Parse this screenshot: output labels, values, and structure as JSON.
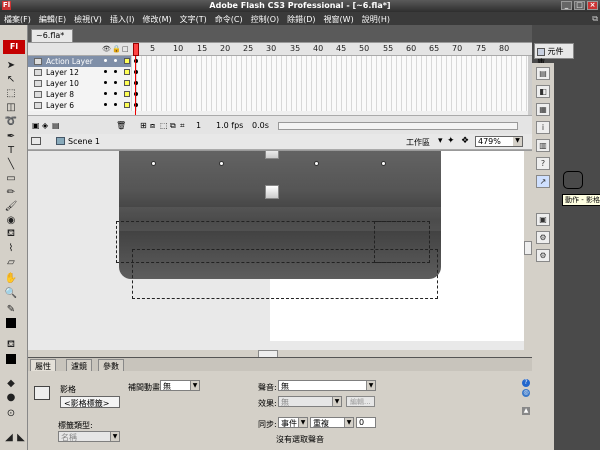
{
  "window": {
    "title": "Adobe Flash CS3 Professional - [~6.fla*]",
    "app_icon": "Fl"
  },
  "menu": [
    "檔案(F)",
    "編輯(E)",
    "檢視(V)",
    "插入(I)",
    "修改(M)",
    "文字(T)",
    "命令(C)",
    "控制(O)",
    "除錯(D)",
    "視窗(W)",
    "說明(H)"
  ],
  "document": {
    "tab": "~6.fla*"
  },
  "timeline": {
    "frame_numbers": [
      "5",
      "10",
      "15",
      "20",
      "25",
      "30",
      "35",
      "40",
      "45",
      "50",
      "55",
      "60",
      "65",
      "70",
      "75",
      "80"
    ],
    "layers": [
      {
        "name": "Action Layer",
        "selected": true
      },
      {
        "name": "Layer 12",
        "selected": false
      },
      {
        "name": "Layer 10",
        "selected": false
      },
      {
        "name": "Layer 8",
        "selected": false
      },
      {
        "name": "Layer 6",
        "selected": false
      }
    ],
    "current_frame": "1",
    "fps": "1.0 fps",
    "time": "0.0s"
  },
  "scene": {
    "label": "Scene 1",
    "workspace": "工作區",
    "zoom": "479%"
  },
  "properties": {
    "tabs": [
      "屬性",
      "濾鏡",
      "參數"
    ],
    "frame_label": "影格",
    "frame_name_placeholder": "<影格標籤>",
    "label_type_label": "標籤類型:",
    "label_type_value": "名稱",
    "tween_label": "補間動畫:",
    "tween_value": "無",
    "sound_label": "聲音:",
    "sound_value": "無",
    "effect_label": "效果:",
    "effect_value": "無",
    "edit_button": "編輯...",
    "sync_label": "同步:",
    "sync_value": "事件",
    "repeat_value": "重複",
    "repeat_count": "0",
    "no_sound": "沒有選取聲音"
  },
  "right_panel": {
    "library_button": "元件庫",
    "tooltip": "動作 - 影格"
  }
}
